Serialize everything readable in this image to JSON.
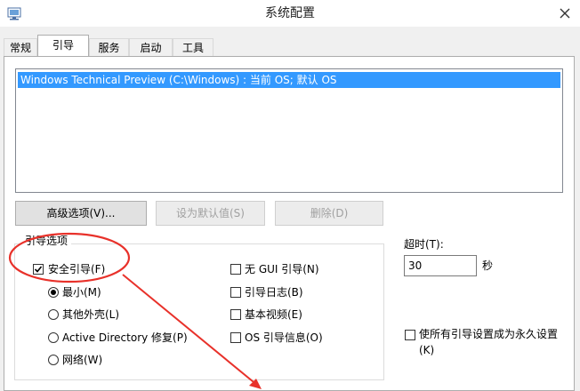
{
  "window": {
    "title": "系统配置"
  },
  "tabs": [
    {
      "label": "常规"
    },
    {
      "label": "引导",
      "active": true
    },
    {
      "label": "服务"
    },
    {
      "label": "启动"
    },
    {
      "label": "工具"
    }
  ],
  "boot_list": {
    "entries": [
      {
        "text": "Windows Technical Preview (C:\\Windows) : 当前 OS; 默认 OS",
        "selected": true
      }
    ]
  },
  "buttons": {
    "advanced": "高级选项(V)...",
    "set_default": "设为默认值(S)",
    "delete": "删除(D)"
  },
  "boot_options": {
    "legend": "引导选项",
    "safe_boot": {
      "label": "安全引导(F)",
      "checked": true
    },
    "radios": [
      {
        "label": "最小(M)",
        "selected": true
      },
      {
        "label": "其他外壳(L)",
        "selected": false
      },
      {
        "label": "Active Directory 修复(P)",
        "selected": false
      },
      {
        "label": "网络(W)",
        "selected": false
      }
    ],
    "checks": [
      {
        "label": "无 GUI 引导(N)",
        "checked": false
      },
      {
        "label": "引导日志(B)",
        "checked": false
      },
      {
        "label": "基本视频(E)",
        "checked": false
      },
      {
        "label": "OS 引导信息(O)",
        "checked": false
      }
    ]
  },
  "timeout": {
    "label": "超时(T):",
    "value": "30",
    "unit": "秒"
  },
  "permanent": {
    "label_line1": "使所有引导设置成为永久设置",
    "label_line2": "(K)",
    "checked": false
  },
  "annotation": {
    "color": "#e8312a"
  },
  "colors": {
    "selection": "#3399ff",
    "panel_bg": "#f0f0f0"
  }
}
